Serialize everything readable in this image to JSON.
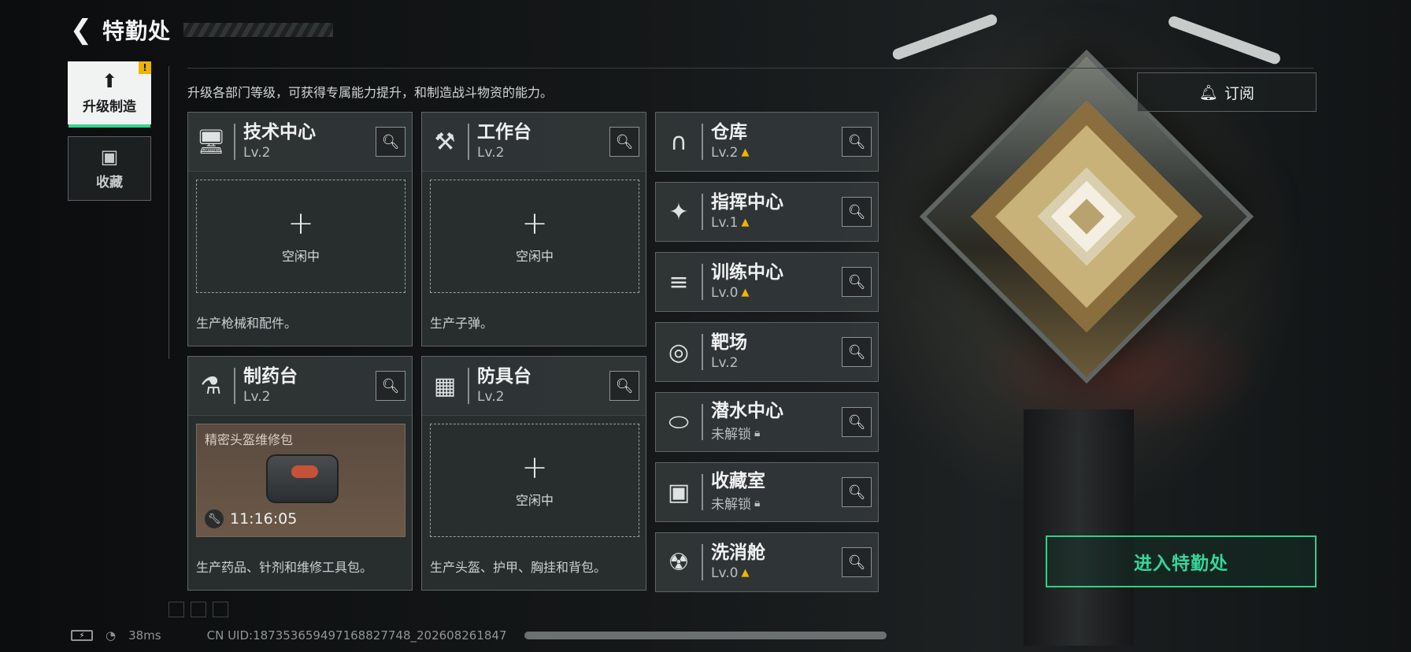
{
  "header": {
    "back_icon": "back-arrow-icon",
    "title": "特勤处"
  },
  "tabs": [
    {
      "label": "升级制造",
      "icon": "upgrade-icon",
      "alert": "!"
    },
    {
      "label": "收藏",
      "icon": "collection-icon"
    }
  ],
  "description": "升级各部门等级，可获得专属能力提升，和制造战斗物资的能力。",
  "cards": [
    {
      "name": "技术中心",
      "level": "Lv.2",
      "icon": "tech-center-icon",
      "slot_plus": "+",
      "slot_status": "空闲中",
      "product": "生产枪械和配件。"
    },
    {
      "name": "工作台",
      "level": "Lv.2",
      "icon": "workbench-icon",
      "slot_plus": "+",
      "slot_status": "空闲中",
      "product": "生产子弹。"
    },
    {
      "name": "制药台",
      "level": "Lv.2",
      "icon": "pharmacy-icon",
      "crafting_item": "精密头盔维修包",
      "crafting_timer": "11:16:05",
      "product": "生产药品、针剂和维修工具包。"
    },
    {
      "name": "防具台",
      "level": "Lv.2",
      "icon": "armor-bench-icon",
      "slot_plus": "+",
      "slot_status": "空闲中",
      "product": "生产头盔、护甲、胸挂和背包。"
    }
  ],
  "facilities": [
    {
      "name": "仓库",
      "level": "Lv.2",
      "upgradable": true,
      "icon": "warehouse-icon"
    },
    {
      "name": "指挥中心",
      "level": "Lv.1",
      "upgradable": true,
      "icon": "command-center-icon"
    },
    {
      "name": "训练中心",
      "level": "Lv.0",
      "upgradable": true,
      "icon": "training-center-icon"
    },
    {
      "name": "靶场",
      "level": "Lv.2",
      "upgradable": false,
      "icon": "shooting-range-icon"
    },
    {
      "name": "潜水中心",
      "level": "未解锁",
      "locked": true,
      "icon": "diving-center-icon"
    },
    {
      "name": "收藏室",
      "level": "未解锁",
      "locked": true,
      "icon": "collection-room-icon"
    },
    {
      "name": "洗消舱",
      "level": "Lv.0",
      "upgradable": true,
      "icon": "decon-chamber-icon"
    }
  ],
  "subscribe_label": "订阅",
  "enter_button": "进入特勤处",
  "footer": {
    "ping": "38ms",
    "uid": "CN UID:18735365949716882774​8_20260826​1847"
  },
  "colors": {
    "accent": "#2fd188",
    "upgrade": "#f0b400"
  }
}
